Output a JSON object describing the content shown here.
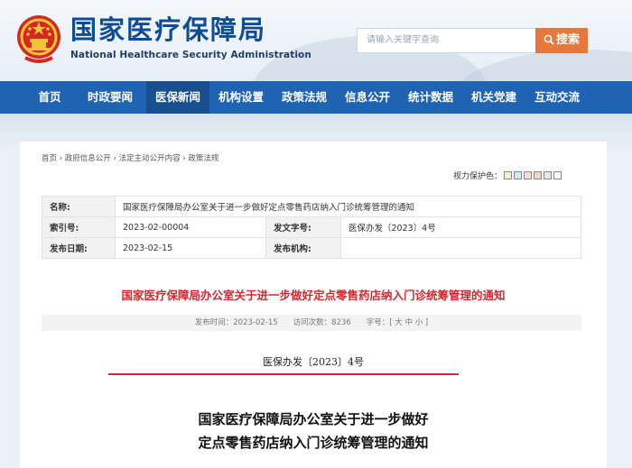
{
  "header": {
    "title_cn": "国家医疗保障局",
    "title_en": "National Healthcare Security Administration",
    "search_placeholder": "请输入关键字查询",
    "search_button": "搜索"
  },
  "nav": {
    "items": [
      {
        "label": "首页",
        "active": false
      },
      {
        "label": "时政要闻",
        "active": false
      },
      {
        "label": "医保新闻",
        "active": true
      },
      {
        "label": "机构设置",
        "active": false
      },
      {
        "label": "政策法规",
        "active": false
      },
      {
        "label": "信息公开",
        "active": false
      },
      {
        "label": "统计数据",
        "active": false
      },
      {
        "label": "机关党建",
        "active": false
      },
      {
        "label": "互动交流",
        "active": false
      }
    ]
  },
  "breadcrumb": "首页 › 政府信息公开 › 法定主动公开内容 › 政策法规",
  "vision": {
    "label": "视力保护色：",
    "colors": [
      "#f7f2c8",
      "#cfe9f5",
      "#f6d8e6",
      "#f2d4c2",
      "#e6e6e6",
      "#ffffff"
    ]
  },
  "meta": {
    "name_label": "名称:",
    "name_value": "国家医疗保障局办公室关于进一步做好定点零售药店纳入门诊统筹管理的通知",
    "index_label": "索引号:",
    "index_value": "2023-02-00004",
    "docno_label": "发文字号:",
    "docno_value": "医保办发〔2023〕4号",
    "date_label": "发布日期:",
    "date_value": "2023-02-15",
    "org_label": "发布机构:",
    "org_value": ""
  },
  "article": {
    "title": "国家医疗保障局办公室关于进一步做好定点零售药店纳入门诊统筹管理的通知",
    "info": "发布时间：2023-02-15　　访问次数：8236　　字号：[ 大 中 小 ]",
    "doc_number": "医保办发〔2023〕4号",
    "heading_line1": "国家医疗保障局办公室关于进一步做好",
    "heading_line2": "定点零售药店纳入门诊统筹管理的通知"
  },
  "colors": {
    "nav": "#1f63b3",
    "nav_active": "#174f91",
    "accent": "#e8773a",
    "title_red": "#d8262c"
  }
}
